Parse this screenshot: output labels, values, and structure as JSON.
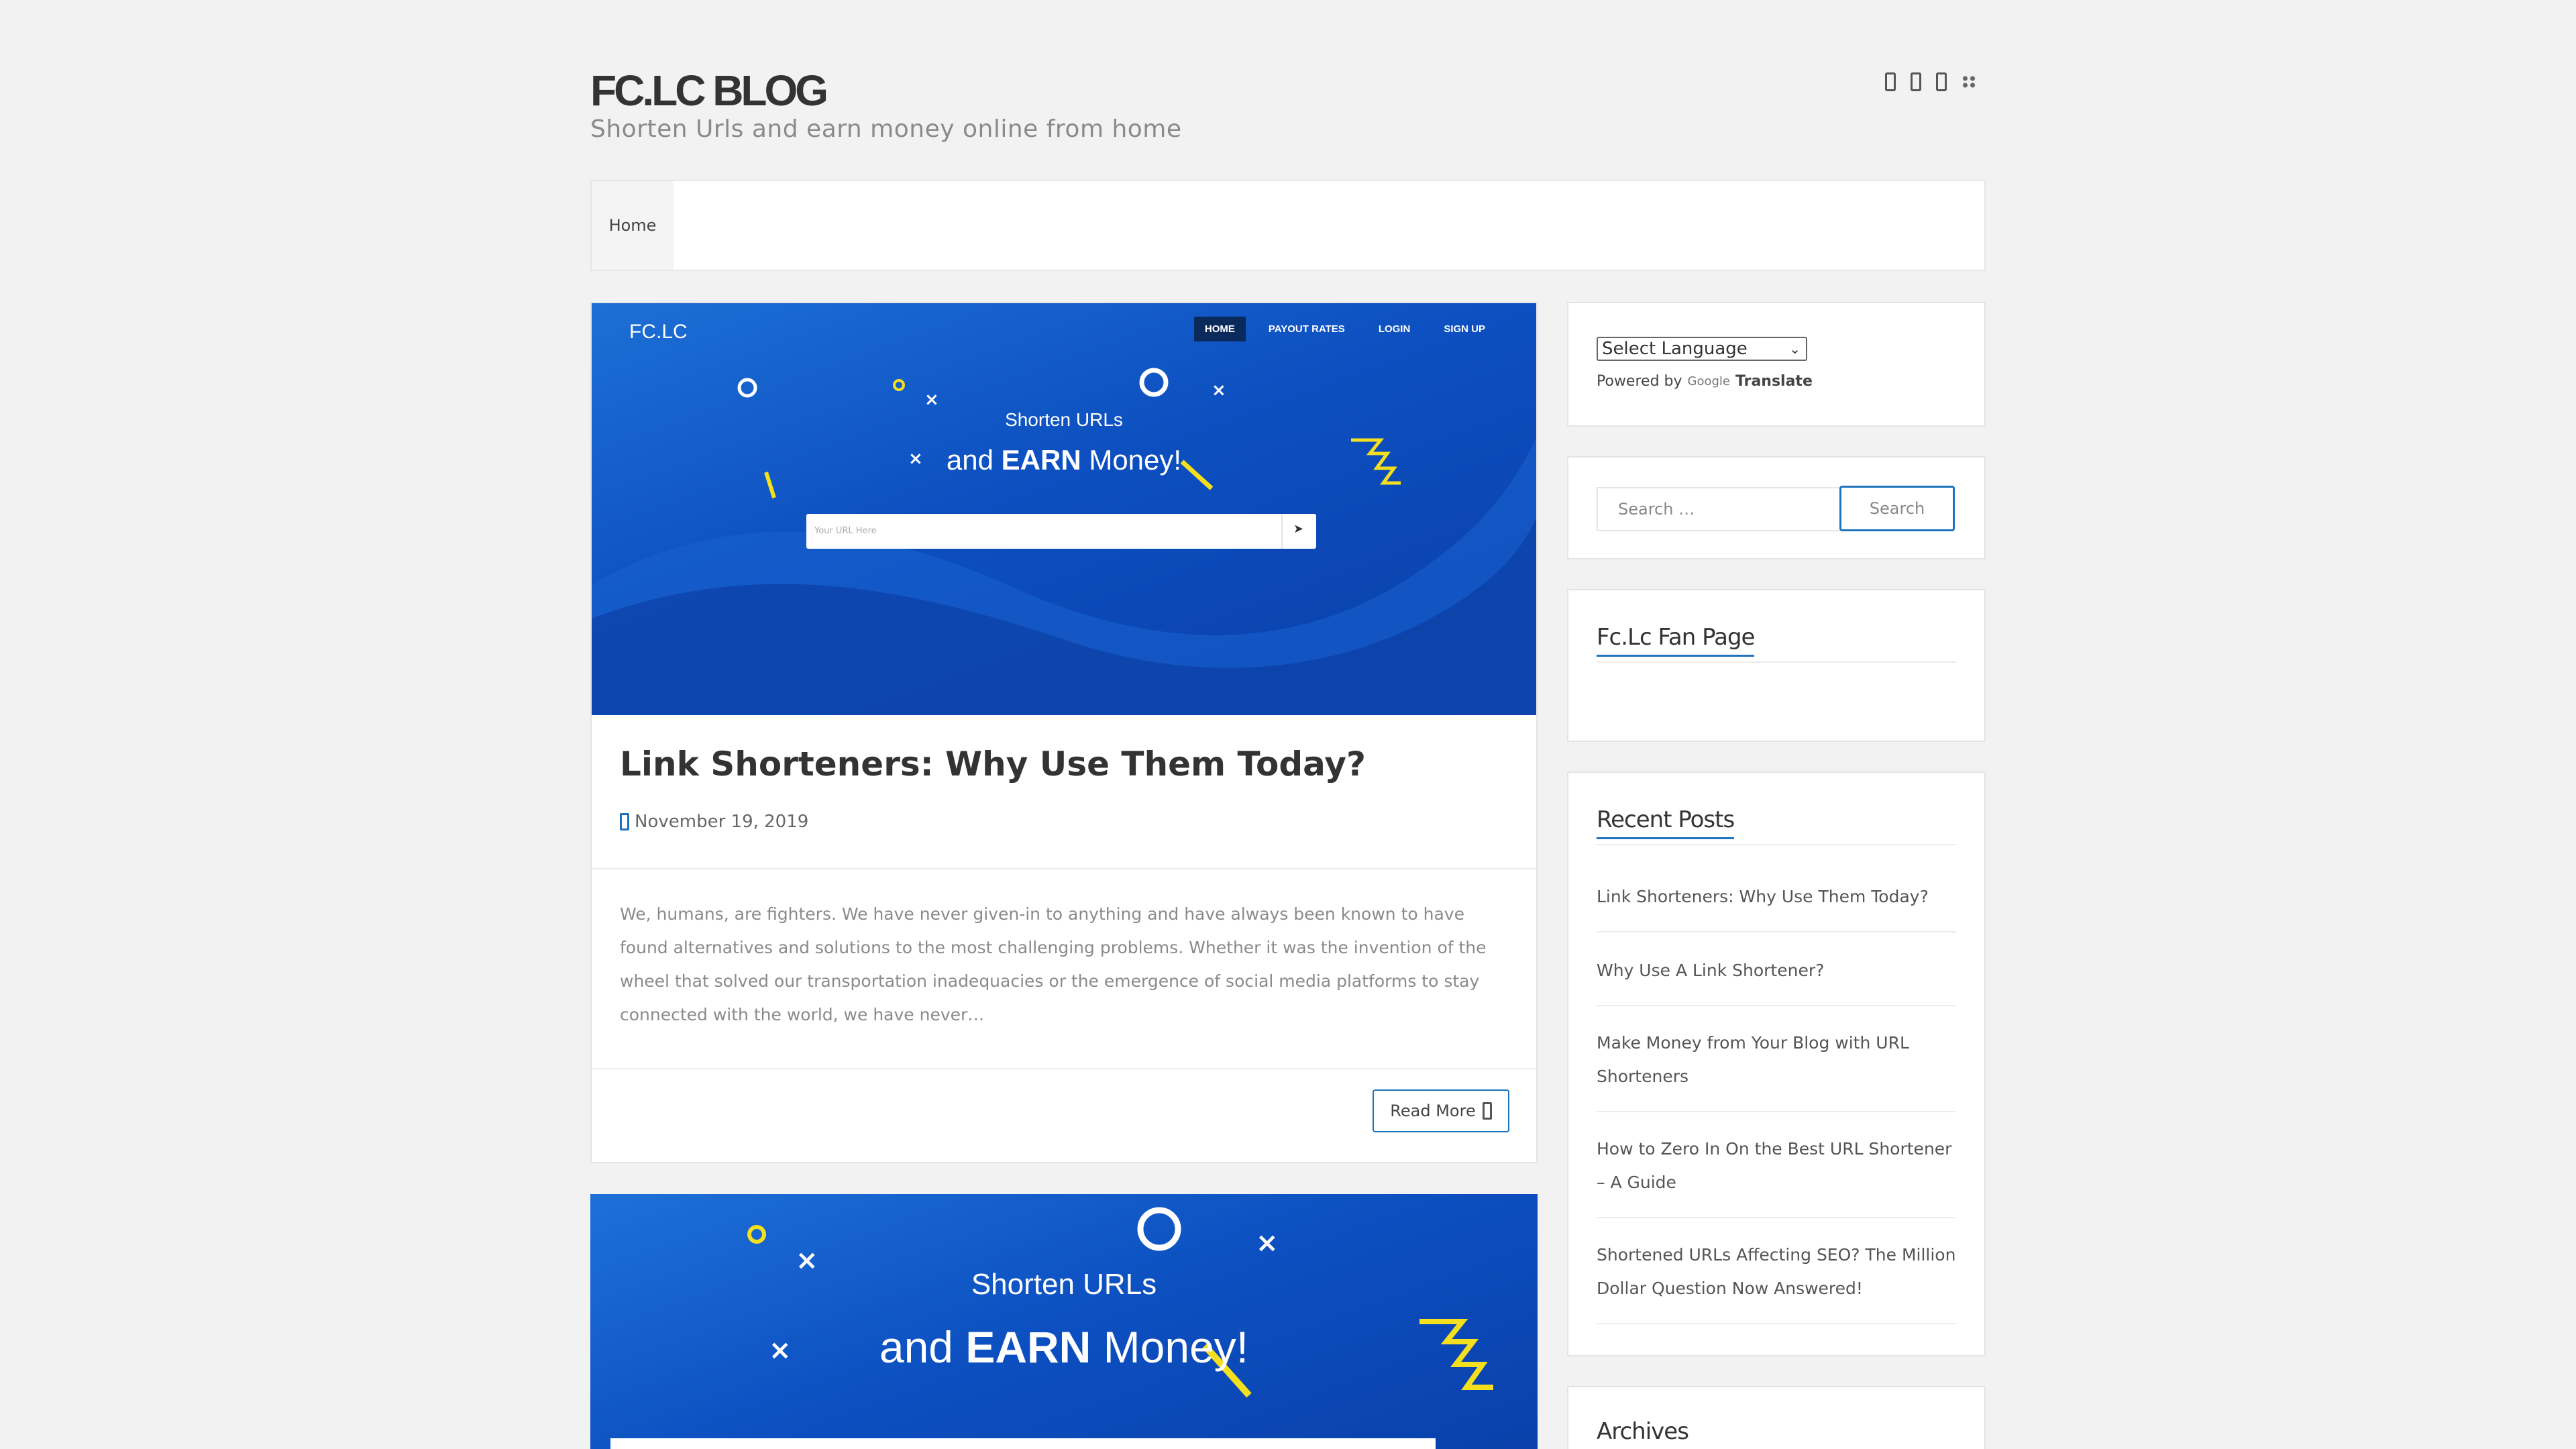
{
  "header": {
    "site_title": "FC.LC BLOG",
    "site_description": "Shorten Urls and earn money online from home",
    "social_icons": [
      "social-icon-1",
      "social-icon-2",
      "social-icon-3",
      "grid-icon"
    ]
  },
  "nav": {
    "items": [
      {
        "label": "Home"
      }
    ]
  },
  "posts": [
    {
      "image": {
        "logo": "FC.LC",
        "nav": [
          "HOME",
          "PAYOUT RATES",
          "LOGIN",
          "SIGN UP"
        ],
        "headline_line1": "Shorten URLs",
        "headline_line2_pre": "and ",
        "headline_line2_bold": "EARN",
        "headline_line2_post": " Money!",
        "input_placeholder": "Your URL Here"
      },
      "title": "Link Shorteners: Why Use Them Today?",
      "date": "November 19, 2019",
      "excerpt": "We, humans, are fighters. We have never given-in to anything and have always been known to have found alternatives and solutions to the most challenging problems. Whether it was the invention of the wheel that solved our transportation inadequacies or the emergence of social media platforms to stay connected with the world, we have never…",
      "read_more": "Read More"
    },
    {
      "image": {
        "headline_line1": "Shorten URLs",
        "headline_line2_pre": "and ",
        "headline_line2_bold": "EARN",
        "headline_line2_post": " Money!"
      }
    }
  ],
  "sidebar": {
    "translate": {
      "select_value": "Select Language",
      "powered_by": "Powered by",
      "google": "Google",
      "translate": "Translate"
    },
    "search": {
      "placeholder": "Search …",
      "button": "Search"
    },
    "fan_page": {
      "title": "Fc.Lc Fan Page"
    },
    "recent_posts": {
      "title": "Recent Posts",
      "items": [
        "Link Shorteners: Why Use Them Today?",
        "Why Use A Link Shortener?",
        "Make Money from Your Blog with URL Shorteners",
        "How to Zero In On the Best URL Shortener – A Guide",
        "Shortened URLs Affecting SEO? The Million Dollar Question Now Answered!"
      ]
    },
    "archives": {
      "title": "Archives"
    }
  },
  "colors": {
    "accent": "#1e73be",
    "background": "#f2f2f2",
    "banner_blue": "#0d4fc0",
    "decor_yellow": "#f4e01e"
  }
}
